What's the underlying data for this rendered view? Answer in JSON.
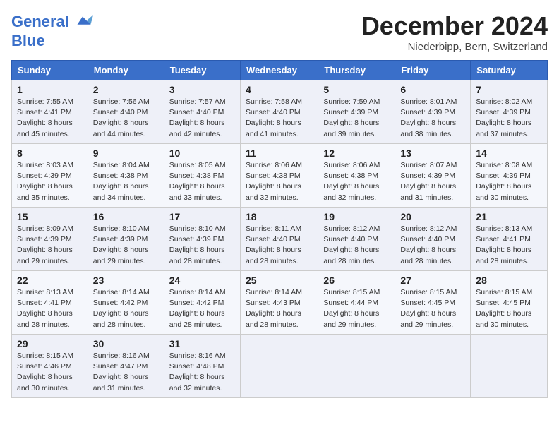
{
  "header": {
    "logo_line1": "General",
    "logo_line2": "Blue",
    "month": "December 2024",
    "location": "Niederbipp, Bern, Switzerland"
  },
  "weekdays": [
    "Sunday",
    "Monday",
    "Tuesday",
    "Wednesday",
    "Thursday",
    "Friday",
    "Saturday"
  ],
  "weeks": [
    [
      {
        "day": "1",
        "info": "Sunrise: 7:55 AM\nSunset: 4:41 PM\nDaylight: 8 hours\nand 45 minutes."
      },
      {
        "day": "2",
        "info": "Sunrise: 7:56 AM\nSunset: 4:40 PM\nDaylight: 8 hours\nand 44 minutes."
      },
      {
        "day": "3",
        "info": "Sunrise: 7:57 AM\nSunset: 4:40 PM\nDaylight: 8 hours\nand 42 minutes."
      },
      {
        "day": "4",
        "info": "Sunrise: 7:58 AM\nSunset: 4:40 PM\nDaylight: 8 hours\nand 41 minutes."
      },
      {
        "day": "5",
        "info": "Sunrise: 7:59 AM\nSunset: 4:39 PM\nDaylight: 8 hours\nand 39 minutes."
      },
      {
        "day": "6",
        "info": "Sunrise: 8:01 AM\nSunset: 4:39 PM\nDaylight: 8 hours\nand 38 minutes."
      },
      {
        "day": "7",
        "info": "Sunrise: 8:02 AM\nSunset: 4:39 PM\nDaylight: 8 hours\nand 37 minutes."
      }
    ],
    [
      {
        "day": "8",
        "info": "Sunrise: 8:03 AM\nSunset: 4:39 PM\nDaylight: 8 hours\nand 35 minutes."
      },
      {
        "day": "9",
        "info": "Sunrise: 8:04 AM\nSunset: 4:38 PM\nDaylight: 8 hours\nand 34 minutes."
      },
      {
        "day": "10",
        "info": "Sunrise: 8:05 AM\nSunset: 4:38 PM\nDaylight: 8 hours\nand 33 minutes."
      },
      {
        "day": "11",
        "info": "Sunrise: 8:06 AM\nSunset: 4:38 PM\nDaylight: 8 hours\nand 32 minutes."
      },
      {
        "day": "12",
        "info": "Sunrise: 8:06 AM\nSunset: 4:38 PM\nDaylight: 8 hours\nand 32 minutes."
      },
      {
        "day": "13",
        "info": "Sunrise: 8:07 AM\nSunset: 4:39 PM\nDaylight: 8 hours\nand 31 minutes."
      },
      {
        "day": "14",
        "info": "Sunrise: 8:08 AM\nSunset: 4:39 PM\nDaylight: 8 hours\nand 30 minutes."
      }
    ],
    [
      {
        "day": "15",
        "info": "Sunrise: 8:09 AM\nSunset: 4:39 PM\nDaylight: 8 hours\nand 29 minutes."
      },
      {
        "day": "16",
        "info": "Sunrise: 8:10 AM\nSunset: 4:39 PM\nDaylight: 8 hours\nand 29 minutes."
      },
      {
        "day": "17",
        "info": "Sunrise: 8:10 AM\nSunset: 4:39 PM\nDaylight: 8 hours\nand 28 minutes."
      },
      {
        "day": "18",
        "info": "Sunrise: 8:11 AM\nSunset: 4:40 PM\nDaylight: 8 hours\nand 28 minutes."
      },
      {
        "day": "19",
        "info": "Sunrise: 8:12 AM\nSunset: 4:40 PM\nDaylight: 8 hours\nand 28 minutes."
      },
      {
        "day": "20",
        "info": "Sunrise: 8:12 AM\nSunset: 4:40 PM\nDaylight: 8 hours\nand 28 minutes."
      },
      {
        "day": "21",
        "info": "Sunrise: 8:13 AM\nSunset: 4:41 PM\nDaylight: 8 hours\nand 28 minutes."
      }
    ],
    [
      {
        "day": "22",
        "info": "Sunrise: 8:13 AM\nSunset: 4:41 PM\nDaylight: 8 hours\nand 28 minutes."
      },
      {
        "day": "23",
        "info": "Sunrise: 8:14 AM\nSunset: 4:42 PM\nDaylight: 8 hours\nand 28 minutes."
      },
      {
        "day": "24",
        "info": "Sunrise: 8:14 AM\nSunset: 4:42 PM\nDaylight: 8 hours\nand 28 minutes."
      },
      {
        "day": "25",
        "info": "Sunrise: 8:14 AM\nSunset: 4:43 PM\nDaylight: 8 hours\nand 28 minutes."
      },
      {
        "day": "26",
        "info": "Sunrise: 8:15 AM\nSunset: 4:44 PM\nDaylight: 8 hours\nand 29 minutes."
      },
      {
        "day": "27",
        "info": "Sunrise: 8:15 AM\nSunset: 4:45 PM\nDaylight: 8 hours\nand 29 minutes."
      },
      {
        "day": "28",
        "info": "Sunrise: 8:15 AM\nSunset: 4:45 PM\nDaylight: 8 hours\nand 30 minutes."
      }
    ],
    [
      {
        "day": "29",
        "info": "Sunrise: 8:15 AM\nSunset: 4:46 PM\nDaylight: 8 hours\nand 30 minutes."
      },
      {
        "day": "30",
        "info": "Sunrise: 8:16 AM\nSunset: 4:47 PM\nDaylight: 8 hours\nand 31 minutes."
      },
      {
        "day": "31",
        "info": "Sunrise: 8:16 AM\nSunset: 4:48 PM\nDaylight: 8 hours\nand 32 minutes."
      },
      {
        "day": "",
        "info": ""
      },
      {
        "day": "",
        "info": ""
      },
      {
        "day": "",
        "info": ""
      },
      {
        "day": "",
        "info": ""
      }
    ]
  ]
}
